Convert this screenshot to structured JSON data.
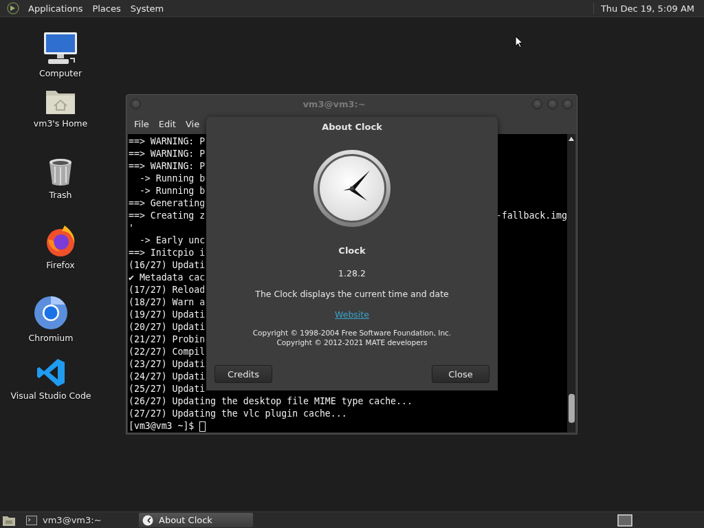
{
  "top_panel": {
    "menus": [
      "Applications",
      "Places",
      "System"
    ],
    "clock": "Thu Dec 19,  5:09 AM"
  },
  "desktop_icons": [
    {
      "label": "Computer",
      "kind": "computer"
    },
    {
      "label": "vm3's Home",
      "kind": "home"
    },
    {
      "label": "Trash",
      "kind": "trash"
    },
    {
      "label": "Firefox",
      "kind": "firefox"
    },
    {
      "label": "Chromium",
      "kind": "chromium"
    },
    {
      "label": "Visual Studio Code",
      "kind": "vscode"
    }
  ],
  "terminal": {
    "title": "vm3@vm3:~",
    "menus": [
      "File",
      "Edit",
      "Vie"
    ],
    "lines": [
      {
        "text": "==> WARNING: P"
      },
      {
        "text": "==> WARNING: P"
      },
      {
        "text": "==> WARNING: P"
      },
      {
        "text": "  -> Running b"
      },
      {
        "text": "  -> Running b"
      },
      {
        "text": "==> Generating"
      },
      {
        "text": "==> Creating z",
        "right": "-fallback.img"
      },
      {
        "text": "'"
      },
      {
        "text": "  -> Early unc"
      },
      {
        "text": "==> Initcpio i"
      },
      {
        "text": "(16/27) Updati"
      },
      {
        "text": "✔ Metadata cac"
      },
      {
        "text": "(17/27) Reload"
      },
      {
        "text": "(18/27) Warn a"
      },
      {
        "text": "(19/27) Updati"
      },
      {
        "text": "(20/27) Updati"
      },
      {
        "text": "(21/27) Probin"
      },
      {
        "text": "(22/27) Compil"
      },
      {
        "text": "(23/27) Updati"
      },
      {
        "text": "(24/27) Updati"
      },
      {
        "text": "(25/27) Updati"
      },
      {
        "text": "(26/27) Updating the desktop file MIME type cache..."
      },
      {
        "text": "(27/27) Updating the vlc plugin cache..."
      }
    ],
    "prompt": "[vm3@vm3 ~]$"
  },
  "dialog": {
    "title": "About Clock",
    "app_name": "Clock",
    "version": "1.28.2",
    "description": "The Clock displays the current time and date",
    "link": "Website",
    "copyright": [
      "Copyright © 1998-2004 Free Software Foundation, Inc.",
      "Copyright © 2012-2021 MATE developers"
    ],
    "buttons": [
      "Credits",
      "Close"
    ]
  },
  "taskbar": {
    "tasks": [
      {
        "label": "vm3@vm3:~",
        "kind": "terminal",
        "selected": false
      },
      {
        "label": "About Clock",
        "kind": "clock",
        "selected": true
      }
    ]
  }
}
